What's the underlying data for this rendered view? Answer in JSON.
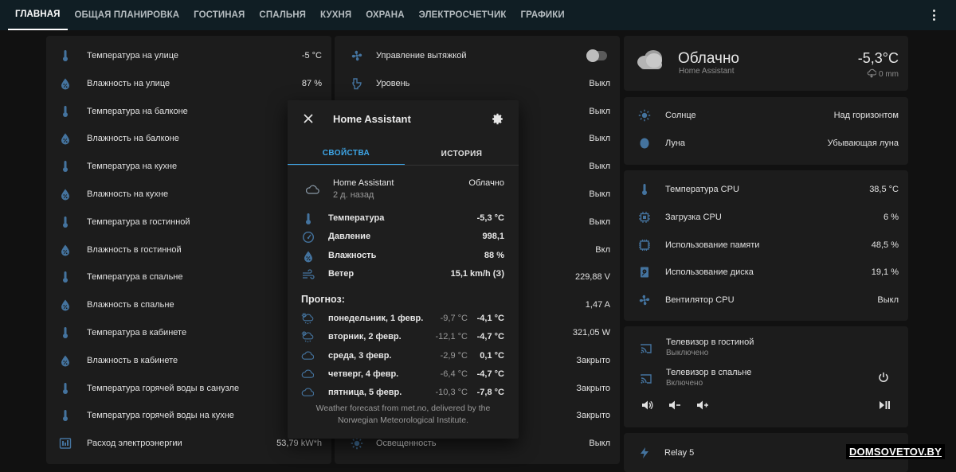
{
  "tabs": [
    "ГЛАВНАЯ",
    "ОБЩАЯ ПЛАНИРОВКА",
    "ГОСТИНАЯ",
    "СПАЛЬНЯ",
    "КУХНЯ",
    "ОХРАНА",
    "ЭЛЕКТРОСЧЕТЧИК",
    "ГРАФИКИ"
  ],
  "sensors_left": [
    {
      "label": "Температура на улице",
      "value": "-5 °C",
      "icon": "thermometer-icon"
    },
    {
      "label": "Влажность на улице",
      "value": "87 %",
      "icon": "water-percent-icon"
    },
    {
      "label": "Температура на балконе",
      "value": "",
      "icon": "thermometer-icon"
    },
    {
      "label": "Влажность на балконе",
      "value": "",
      "icon": "water-percent-icon"
    },
    {
      "label": "Температура на кухне",
      "value": "",
      "icon": "thermometer-icon"
    },
    {
      "label": "Влажность на кухне",
      "value": "",
      "icon": "water-percent-icon"
    },
    {
      "label": "Температура в гостинной",
      "value": "",
      "icon": "thermometer-icon"
    },
    {
      "label": "Влажность в гостинной",
      "value": "",
      "icon": "water-percent-icon"
    },
    {
      "label": "Температура в спальне",
      "value": "",
      "icon": "thermometer-icon"
    },
    {
      "label": "Влажность в спальне",
      "value": "",
      "icon": "water-percent-icon"
    },
    {
      "label": "Температура в кабинете",
      "value": "",
      "icon": "thermometer-icon"
    },
    {
      "label": "Влажность в кабинете",
      "value": "",
      "icon": "water-percent-icon"
    },
    {
      "label": "Температура горячей воды в санузле",
      "value": "",
      "icon": "thermometer-icon"
    },
    {
      "label": "Температура горячей воды на кухне",
      "value": "",
      "icon": "thermometer-icon"
    },
    {
      "label": "Расход электроэнергии",
      "value": "53,79 kW*h",
      "icon": "meter-icon"
    }
  ],
  "middle": {
    "rows": [
      {
        "label": "Управление вытяжкой",
        "value": "",
        "icon": "fan-icon"
      },
      {
        "label": "Уровень",
        "value": "Выкл",
        "icon": "toilet-icon"
      },
      {
        "label": "",
        "value": "Выкл"
      },
      {
        "label": "",
        "value": "Выкл"
      },
      {
        "label": "",
        "value": "Выкл"
      },
      {
        "label": "",
        "value": "Выкл"
      },
      {
        "label": "",
        "value": "Выкл"
      },
      {
        "label": "",
        "value": "Вкл"
      },
      {
        "label": "",
        "value": "229,88 V"
      },
      {
        "label": "",
        "value": "1,47 A"
      },
      {
        "label": "",
        "value": "321,05 W"
      },
      {
        "label": "",
        "value": "Закрыто"
      },
      {
        "label": "",
        "value": "Закрыто"
      },
      {
        "label": "",
        "value": "Закрыто"
      },
      {
        "label": "Освещенность",
        "value": "Выкл",
        "icon": "sun-icon"
      }
    ]
  },
  "weather_card": {
    "state": "Облачно",
    "name": "Home Assistant",
    "temperature": "-5,3°C",
    "precipitation": "0 mm"
  },
  "sun_moon": [
    {
      "label": "Солнце",
      "value": "Над горизонтом",
      "icon": "sun-icon"
    },
    {
      "label": "Луна",
      "value": "Убывающая луна",
      "icon": "moon-icon"
    }
  ],
  "system": [
    {
      "label": "Температура CPU",
      "value": "38,5 °C",
      "icon": "thermometer-icon"
    },
    {
      "label": "Загрузка CPU",
      "value": "6 %",
      "icon": "cpu-icon"
    },
    {
      "label": "Использование памяти",
      "value": "48,5 %",
      "icon": "memory-icon"
    },
    {
      "label": "Использование диска",
      "value": "19,1 %",
      "icon": "harddisk-icon"
    },
    {
      "label": "Вентилятор CPU",
      "value": "Выкл",
      "icon": "fan-icon"
    }
  ],
  "media": [
    {
      "name": "Телевизор в гостиной",
      "state": "Выключено"
    },
    {
      "name": "Телевизор в спальне",
      "state": "Включено"
    }
  ],
  "relay": {
    "label": "Relay 5"
  },
  "dialog": {
    "title": "Home Assistant",
    "tab_properties": "СВОЙСТВА",
    "tab_history": "ИСТОРИЯ",
    "entity_name": "Home Assistant",
    "entity_age": "2 д. назад",
    "entity_state": "Облачно",
    "attributes": [
      {
        "key": "Температура",
        "value": "-5,3 °C",
        "icon": "thermometer-icon"
      },
      {
        "key": "Давление",
        "value": "998,1",
        "icon": "gauge-icon"
      },
      {
        "key": "Влажность",
        "value": "88 %",
        "icon": "water-percent-icon"
      },
      {
        "key": "Ветер",
        "value": "15,1 km/h (З)",
        "icon": "wind-icon"
      }
    ],
    "forecast_title": "Прогноз:",
    "forecast": [
      {
        "day": "понедельник, 1 февр.",
        "low": "-9,7 °C",
        "high": "-4,1 °C",
        "icon": "partly-snowy-icon"
      },
      {
        "day": "вторник, 2 февр.",
        "low": "-12,1 °C",
        "high": "-4,7 °C",
        "icon": "partly-snowy-icon"
      },
      {
        "day": "среда, 3 февр.",
        "low": "-2,9 °C",
        "high": "0,1 °C",
        "icon": "cloudy-icon"
      },
      {
        "day": "четверг, 4 февр.",
        "low": "-6,4 °C",
        "high": "-4,7 °C",
        "icon": "cloudy-icon"
      },
      {
        "day": "пятница, 5 февр.",
        "low": "-10,3 °C",
        "high": "-7,8 °C",
        "icon": "cloudy-icon"
      }
    ],
    "attribution": "Weather forecast from met.no, delivered by the Norwegian Meteorological Institute."
  },
  "watermark": "DOMSOVETOV.BY",
  "colors": {
    "icon": "#44739e",
    "accent": "#3ea7e9",
    "card": "#1c1c1c",
    "background": "#111111",
    "header": "#101e24"
  }
}
